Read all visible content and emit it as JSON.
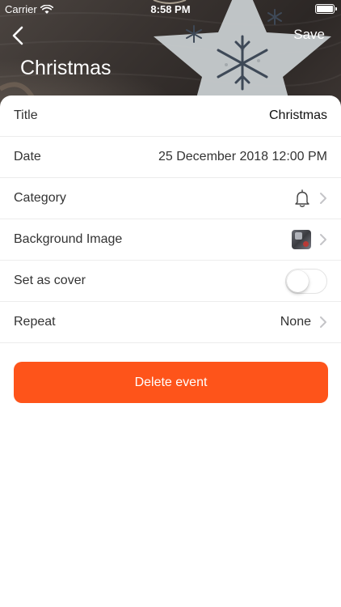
{
  "status_bar": {
    "carrier": "Carrier",
    "time": "8:58 PM"
  },
  "nav": {
    "save_label": "Save"
  },
  "header": {
    "title": "Christmas"
  },
  "form": {
    "rows": [
      {
        "label": "Title",
        "value": "Christmas"
      },
      {
        "label": "Date",
        "value": "25 December 2018 12:00 PM"
      },
      {
        "label": "Category",
        "icon": "bell-icon"
      },
      {
        "label": "Background Image",
        "icon": "image-thumbnail"
      },
      {
        "label": "Set as cover",
        "toggle": false
      },
      {
        "label": "Repeat",
        "value": "None"
      }
    ]
  },
  "actions": {
    "delete_label": "Delete event"
  },
  "colors": {
    "accent": "#fe541a",
    "header_bg": "#3a3431"
  }
}
